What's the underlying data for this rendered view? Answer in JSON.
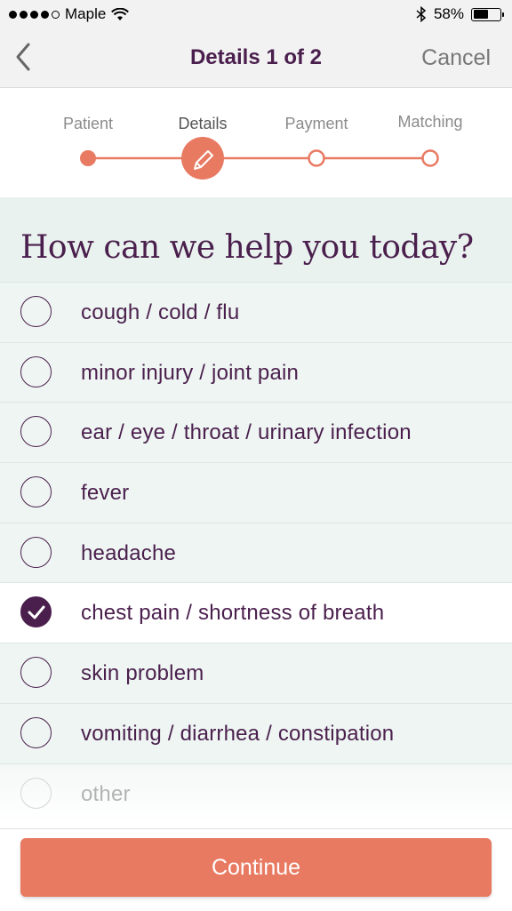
{
  "status": {
    "carrier": "Maple",
    "battery": "58%",
    "battery_level": 0.58
  },
  "nav": {
    "title": "Details 1 of 2",
    "cancel": "Cancel"
  },
  "steps": [
    {
      "label": "Patient",
      "state": "done"
    },
    {
      "label": "Details",
      "state": "current"
    },
    {
      "label": "Payment",
      "state": "todo"
    },
    {
      "label": "Matching",
      "state": "todo"
    }
  ],
  "question": "How can we help you today?",
  "options": [
    {
      "label": "cough / cold / flu",
      "checked": false
    },
    {
      "label": "minor injury / joint pain",
      "checked": false
    },
    {
      "label": "ear / eye / throat / urinary infection",
      "checked": false
    },
    {
      "label": "fever",
      "checked": false
    },
    {
      "label": "headache",
      "checked": false
    },
    {
      "label": "chest pain / shortness of breath",
      "checked": true
    },
    {
      "label": "skin problem",
      "checked": false
    },
    {
      "label": "vomiting / diarrhea / constipation",
      "checked": false
    },
    {
      "label": "other",
      "checked": false
    }
  ],
  "continue_label": "Continue",
  "colors": {
    "accent": "#e87a62",
    "primary": "#4a1f4d",
    "question_bg": "#e9f2ee"
  }
}
